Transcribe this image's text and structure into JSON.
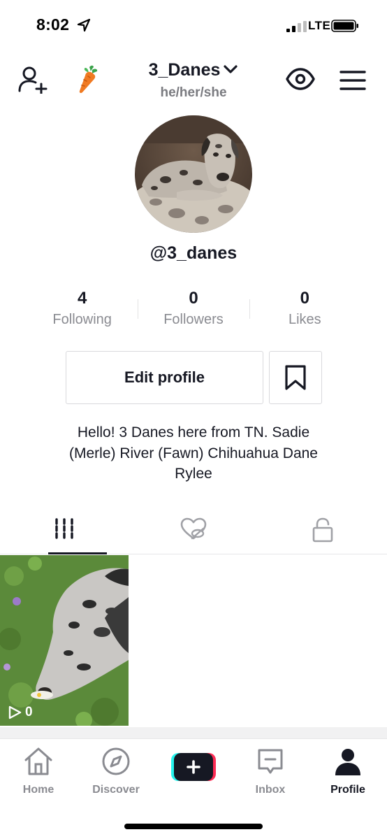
{
  "status_bar": {
    "time": "8:02",
    "network": "LTE"
  },
  "header": {
    "username": "3_Danes",
    "pronouns": "he/her/she"
  },
  "profile": {
    "handle": "@3_danes",
    "stats": [
      {
        "value": "4",
        "label": "Following"
      },
      {
        "value": "0",
        "label": "Followers"
      },
      {
        "value": "0",
        "label": "Likes"
      }
    ],
    "edit_label": "Edit profile",
    "bio_line1": "Hello! 3 Danes here from TN. Sadie",
    "bio_line2": "(Merle) River (Fawn) Chihuahua Dane",
    "bio_line3": "Rylee"
  },
  "tabs": [
    {
      "icon": "videos-grid-icon",
      "active": true
    },
    {
      "icon": "liked-hidden-icon",
      "active": false
    },
    {
      "icon": "private-lock-icon",
      "active": false
    }
  ],
  "videos": [
    {
      "views": "0"
    }
  ],
  "tab_bar": {
    "items": [
      {
        "label": "Home",
        "icon": "home-icon"
      },
      {
        "label": "Discover",
        "icon": "compass-icon"
      },
      {
        "label": "",
        "icon": "create-plus-icon"
      },
      {
        "label": "Inbox",
        "icon": "inbox-icon"
      },
      {
        "label": "Profile",
        "icon": "profile-icon"
      }
    ]
  },
  "colors": {
    "text": "#161823",
    "secondary": "#8a8b91",
    "accent_cyan": "#25f4ee",
    "accent_pink": "#fe2c55",
    "carrot": "#f07a22"
  }
}
